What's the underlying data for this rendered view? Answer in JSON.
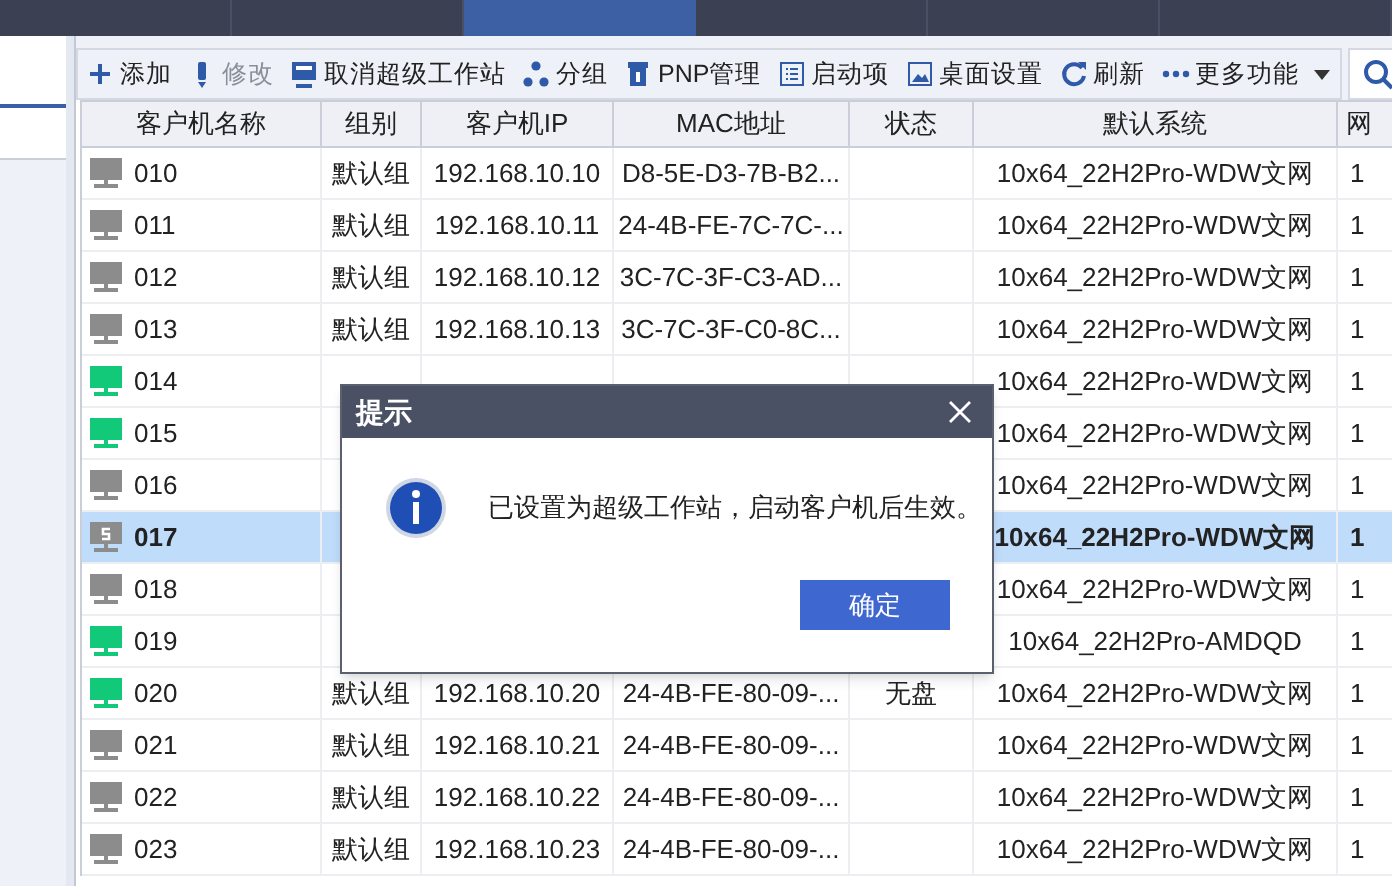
{
  "top_tabs": [
    {
      "selected": false
    },
    {
      "selected": false
    },
    {
      "selected": true
    },
    {
      "selected": false
    },
    {
      "selected": false
    },
    {
      "selected": false
    }
  ],
  "toolbar": [
    {
      "label": "添加",
      "disabled": false,
      "dropdown": false
    },
    {
      "label": "修改",
      "disabled": true,
      "dropdown": false
    },
    {
      "label": "取消超级工作站",
      "disabled": false,
      "dropdown": false
    },
    {
      "label": "分组",
      "disabled": false,
      "dropdown": false
    },
    {
      "label": "PNP管理",
      "disabled": false,
      "dropdown": false
    },
    {
      "label": "启动项",
      "disabled": false,
      "dropdown": false
    },
    {
      "label": "桌面设置",
      "disabled": false,
      "dropdown": false
    },
    {
      "label": "刷新",
      "disabled": false,
      "dropdown": false
    },
    {
      "label": "更多功能",
      "disabled": false,
      "dropdown": true
    }
  ],
  "table": {
    "columns": [
      "客户机名称",
      "组别",
      "客户机IP",
      "MAC地址",
      "状态",
      "默认系统",
      "网"
    ],
    "rows": [
      {
        "kind": "offline",
        "selected": false,
        "cells": [
          "010",
          "默认组",
          "192.168.10.10",
          "D8-5E-D3-7B-B2...",
          "",
          "10x64_22H2Pro-WDW文网",
          "1"
        ]
      },
      {
        "kind": "offline",
        "selected": false,
        "cells": [
          "011",
          "默认组",
          "192.168.10.11",
          "24-4B-FE-7C-7C-...",
          "",
          "10x64_22H2Pro-WDW文网",
          "1"
        ]
      },
      {
        "kind": "offline",
        "selected": false,
        "cells": [
          "012",
          "默认组",
          "192.168.10.12",
          "3C-7C-3F-C3-AD...",
          "",
          "10x64_22H2Pro-WDW文网",
          "1"
        ]
      },
      {
        "kind": "offline",
        "selected": false,
        "cells": [
          "013",
          "默认组",
          "192.168.10.13",
          "3C-7C-3F-C0-8C...",
          "",
          "10x64_22H2Pro-WDW文网",
          "1"
        ]
      },
      {
        "kind": "online",
        "selected": false,
        "cells": [
          "014",
          "",
          "",
          "",
          "",
          "10x64_22H2Pro-WDW文网",
          "1"
        ]
      },
      {
        "kind": "online",
        "selected": false,
        "cells": [
          "015",
          "",
          "",
          "",
          "",
          "10x64_22H2Pro-WDW文网",
          "1"
        ]
      },
      {
        "kind": "offline",
        "selected": false,
        "cells": [
          "016",
          "",
          "",
          "",
          "",
          "10x64_22H2Pro-WDW文网",
          "1"
        ]
      },
      {
        "kind": "super",
        "selected": true,
        "cells": [
          "017",
          "",
          "",
          "",
          "",
          "10x64_22H2Pro-WDW文网",
          "1"
        ]
      },
      {
        "kind": "offline",
        "selected": false,
        "cells": [
          "018",
          "",
          "",
          "",
          "",
          "10x64_22H2Pro-WDW文网",
          "1"
        ]
      },
      {
        "kind": "online",
        "selected": false,
        "cells": [
          "019",
          "",
          "",
          "",
          "",
          "10x64_22H2Pro-AMDQD",
          "1"
        ]
      },
      {
        "kind": "online",
        "selected": false,
        "cells": [
          "020",
          "默认组",
          "192.168.10.20",
          "24-4B-FE-80-09-...",
          "无盘",
          "10x64_22H2Pro-WDW文网",
          "1"
        ]
      },
      {
        "kind": "offline",
        "selected": false,
        "cells": [
          "021",
          "默认组",
          "192.168.10.21",
          "24-4B-FE-80-09-...",
          "",
          "10x64_22H2Pro-WDW文网",
          "1"
        ]
      },
      {
        "kind": "offline",
        "selected": false,
        "cells": [
          "022",
          "默认组",
          "192.168.10.22",
          "24-4B-FE-80-09-...",
          "",
          "10x64_22H2Pro-WDW文网",
          "1"
        ]
      },
      {
        "kind": "offline",
        "selected": false,
        "cells": [
          "023",
          "默认组",
          "192.168.10.23",
          "24-4B-FE-80-09-...",
          "",
          "10x64_22H2Pro-WDW文网",
          "1"
        ]
      }
    ]
  },
  "dialog": {
    "title": "提示",
    "message": "已设置为超级工作站，启动客户机后生效。",
    "button": "确定"
  }
}
